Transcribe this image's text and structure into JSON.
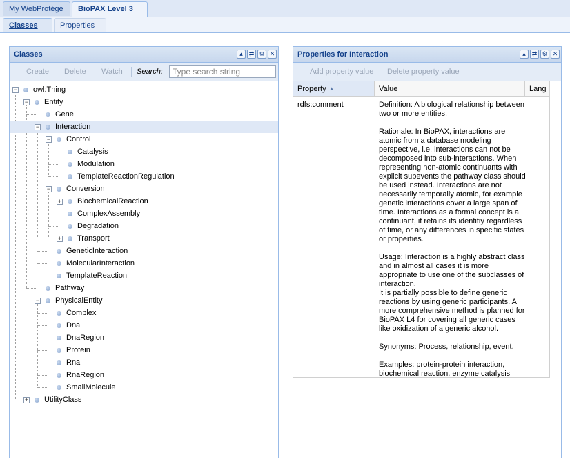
{
  "top_tabs": [
    {
      "label": "My WebProtégé"
    },
    {
      "label": "BioPAX Level 3"
    }
  ],
  "sub_tabs": [
    {
      "label": "Classes"
    },
    {
      "label": "Properties"
    }
  ],
  "classes_panel": {
    "title": "Classes",
    "toolbar": {
      "create": "Create",
      "delete": "Delete",
      "watch": "Watch",
      "search_label": "Search:",
      "search_placeholder": "Type search string"
    },
    "tree": [
      {
        "label": "owl:Thing"
      },
      {
        "label": "Entity"
      },
      {
        "label": "Gene"
      },
      {
        "label": "Interaction"
      },
      {
        "label": "Control"
      },
      {
        "label": "Catalysis"
      },
      {
        "label": "Modulation"
      },
      {
        "label": "TemplateReactionRegulation"
      },
      {
        "label": "Conversion"
      },
      {
        "label": "BiochemicalReaction"
      },
      {
        "label": "ComplexAssembly"
      },
      {
        "label": "Degradation"
      },
      {
        "label": "Transport"
      },
      {
        "label": "GeneticInteraction"
      },
      {
        "label": "MolecularInteraction"
      },
      {
        "label": "TemplateReaction"
      },
      {
        "label": "Pathway"
      },
      {
        "label": "PhysicalEntity"
      },
      {
        "label": "Complex"
      },
      {
        "label": "Dna"
      },
      {
        "label": "DnaRegion"
      },
      {
        "label": "Protein"
      },
      {
        "label": "Rna"
      },
      {
        "label": "RnaRegion"
      },
      {
        "label": "SmallMolecule"
      },
      {
        "label": "UtilityClass"
      }
    ]
  },
  "properties_panel": {
    "title": "Properties for Interaction",
    "toolbar": {
      "add": "Add property value",
      "delete": "Delete property value"
    },
    "columns": {
      "property": "Property",
      "value": "Value",
      "lang": "Lang"
    },
    "row": {
      "property": "rdfs:comment",
      "value": "Definition: A biological relationship between two or more entities.\n\nRationale: In BioPAX, interactions are atomic from a database modeling perspective, i.e. interactions can not be decomposed into sub-interactions. When representing non-atomic continuants with explicit subevents the pathway class should be used instead. Interactions are not necessarily temporally atomic, for example genetic interactions cover a large span of time. Interactions as a formal concept is a continuant, it retains its identitiy regardless of time, or any differences in specific states or properties.\n\nUsage: Interaction is a highly abstract class and in almost all cases it is more appropriate to use one of the subclasses of interaction.\nIt is partially possible to define generic reactions by using generic participants. A more comprehensive method is planned for BioPAX L4 for covering all generic cases like oxidization of a generic alcohol.\n\nSynonyms: Process, relationship, event.\n\nExamples: protein-protein interaction, biochemical reaction, enzyme catalysis"
    }
  },
  "icons": {
    "close": "close-icon",
    "collapse": "collapse-icon",
    "refresh": "refresh-icon",
    "settings": "gear-icon",
    "sort": "sort-ascending-icon",
    "expander": "tree-expander-icon",
    "node": "class-node-icon"
  },
  "colors": {
    "header_text": "#15428b",
    "border": "#99bbe8",
    "selected_row": "#dfe8f6"
  }
}
